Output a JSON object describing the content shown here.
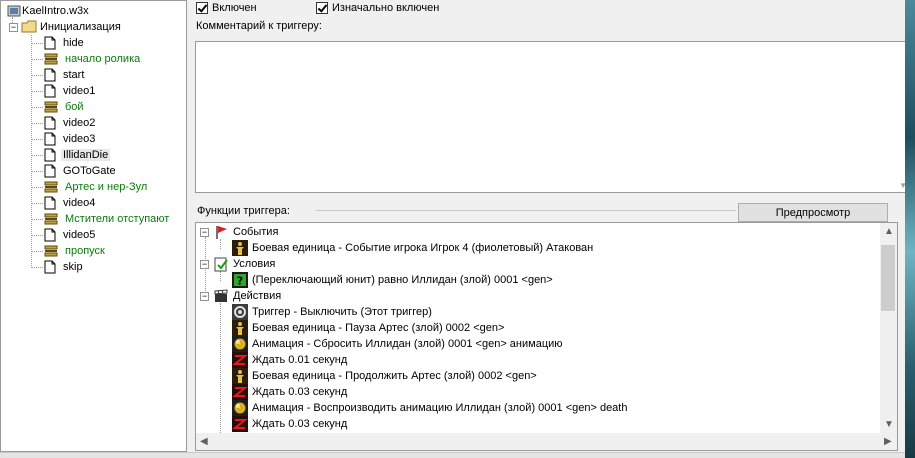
{
  "tree": {
    "root_label": "KaelIntro.w3x",
    "folder": {
      "label": "Инициализация",
      "expander": "−"
    },
    "items": [
      {
        "label": "hide",
        "type": "doc",
        "color": "#000000"
      },
      {
        "label": "начало ролика",
        "type": "comment",
        "color": "#0a7a0a"
      },
      {
        "label": "start",
        "type": "doc",
        "color": "#000000"
      },
      {
        "label": "video1",
        "type": "doc",
        "color": "#000000"
      },
      {
        "label": "бой",
        "type": "comment",
        "color": "#0a7a0a"
      },
      {
        "label": "video2",
        "type": "doc",
        "color": "#000000"
      },
      {
        "label": "video3",
        "type": "doc",
        "color": "#000000"
      },
      {
        "label": "IllidanDie",
        "type": "doc",
        "color": "#000000",
        "selected": true
      },
      {
        "label": "GOToGate",
        "type": "doc",
        "color": "#000000"
      },
      {
        "label": "Артес и нер-Зул",
        "type": "comment",
        "color": "#0a7a0a"
      },
      {
        "label": "video4",
        "type": "doc",
        "color": "#000000"
      },
      {
        "label": "Мстители отступают",
        "type": "comment",
        "color": "#0a7a0a"
      },
      {
        "label": "video5",
        "type": "doc",
        "color": "#000000"
      },
      {
        "label": "пропуск",
        "type": "comment",
        "color": "#0a7a0a"
      },
      {
        "label": "skip",
        "type": "doc",
        "color": "#000000"
      }
    ]
  },
  "trigger": {
    "enabled_label": "Включен",
    "initially_enabled_label": "Изначально включен",
    "comment_label": "Комментарий к триггеру:",
    "comment_value": "",
    "functions_label": "Функции триггера:",
    "preview_button": "Предпросмотр"
  },
  "functions": {
    "events_label": "События",
    "event_1": "Боевая единица - Событие игрока Игрок 4 (фиолетовый) Атакован",
    "conditions_label": "Условия",
    "condition_1": "(Переключающий юнит) равно Иллидан (злой) 0001 <gen>",
    "actions_label": "Действия",
    "actions": [
      {
        "text": "Триггер - Выключить (Этот триггер)",
        "icon": "trigger-icon"
      },
      {
        "text": "Боевая единица - Пауза Артес (злой) 0002 <gen>",
        "icon": "unit-icon"
      },
      {
        "text": "Анимация - Сбросить Иллидан (злой) 0001 <gen> анимацию",
        "icon": "animation-icon"
      },
      {
        "text": "Ждать 0.01 секунд",
        "icon": "wait-icon"
      },
      {
        "text": "Боевая единица - Продолжить Артес (злой) 0002 <gen>",
        "icon": "unit-icon"
      },
      {
        "text": "Ждать 0.03 секунд",
        "icon": "wait-icon"
      },
      {
        "text": "Анимация - Воспроизводить анимацию Иллидан (злой) 0001 <gen> death",
        "icon": "animation-icon"
      },
      {
        "text": "Ждать 0.03 секунд",
        "icon": "wait-icon"
      }
    ]
  }
}
